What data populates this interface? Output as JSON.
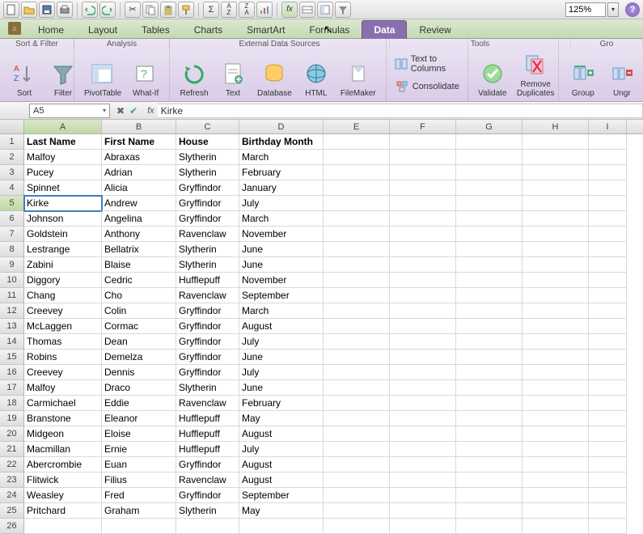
{
  "zoom": "125%",
  "tabs": [
    "Home",
    "Layout",
    "Tables",
    "Charts",
    "SmartArt",
    "Formulas",
    "Data",
    "Review"
  ],
  "active_tab": "Data",
  "ribbon_groups": {
    "sort_filter": {
      "label": "Sort & Filter",
      "sort": "Sort",
      "filter": "Filter"
    },
    "analysis": {
      "label": "Analysis",
      "pivot": "PivotTable",
      "whatif": "What-If"
    },
    "external": {
      "label": "External Data Sources",
      "refresh": "Refresh",
      "text": "Text",
      "database": "Database",
      "html": "HTML",
      "filemaker": "FileMaker"
    },
    "tools": {
      "label": "Tools",
      "t2c": "Text to Columns",
      "consolidate": "Consolidate",
      "validate": "Validate",
      "remove_dup": "Remove\nDuplicates"
    },
    "group_area": {
      "label": "Gro",
      "group": "Group",
      "ungroup": "Ungr"
    }
  },
  "name_box": "A5",
  "formula_value": "Kirke",
  "columns": [
    "A",
    "B",
    "C",
    "D",
    "E",
    "F",
    "G",
    "H",
    "I"
  ],
  "selected_col": "A",
  "selected_row": 5,
  "headers": [
    "Last Name",
    "First Name",
    "House",
    "Birthday Month"
  ],
  "chart_data": {
    "type": "table",
    "columns": [
      "Last Name",
      "First Name",
      "House",
      "Birthday Month"
    ],
    "rows": [
      [
        "Malfoy",
        "Abraxas",
        "Slytherin",
        "March"
      ],
      [
        "Pucey",
        "Adrian",
        "Slytherin",
        "February"
      ],
      [
        "Spinnet",
        "Alicia",
        "Gryffindor",
        "January"
      ],
      [
        "Kirke",
        "Andrew",
        "Gryffindor",
        "July"
      ],
      [
        "Johnson",
        "Angelina",
        "Gryffindor",
        "March"
      ],
      [
        "Goldstein",
        "Anthony",
        "Ravenclaw",
        "November"
      ],
      [
        "Lestrange",
        "Bellatrix",
        "Slytherin",
        "June"
      ],
      [
        "Zabini",
        "Blaise",
        "Slytherin",
        "June"
      ],
      [
        "Diggory",
        "Cedric",
        "Hufflepuff",
        "November"
      ],
      [
        "Chang",
        "Cho",
        "Ravenclaw",
        "September"
      ],
      [
        "Creevey",
        "Colin",
        "Gryffindor",
        "March"
      ],
      [
        "McLaggen",
        "Cormac",
        "Gryffindor",
        "August"
      ],
      [
        "Thomas",
        "Dean",
        "Gryffindor",
        "July"
      ],
      [
        "Robins",
        "Demelza",
        "Gryffindor",
        "June"
      ],
      [
        "Creevey",
        "Dennis",
        "Gryffindor",
        "July"
      ],
      [
        "Malfoy",
        "Draco",
        "Slytherin",
        "June"
      ],
      [
        "Carmichael",
        "Eddie",
        "Ravenclaw",
        "February"
      ],
      [
        "Branstone",
        "Eleanor",
        "Hufflepuff",
        "May"
      ],
      [
        "Midgeon",
        "Eloise",
        "Hufflepuff",
        "August"
      ],
      [
        "Macmillan",
        "Ernie",
        "Hufflepuff",
        "July"
      ],
      [
        "Abercrombie",
        "Euan",
        "Gryffindor",
        "August"
      ],
      [
        "Flitwick",
        "Filius",
        "Ravenclaw",
        "August"
      ],
      [
        "Weasley",
        "Fred",
        "Gryffindor",
        "September"
      ],
      [
        "Pritchard",
        "Graham",
        "Slytherin",
        "May"
      ]
    ]
  }
}
